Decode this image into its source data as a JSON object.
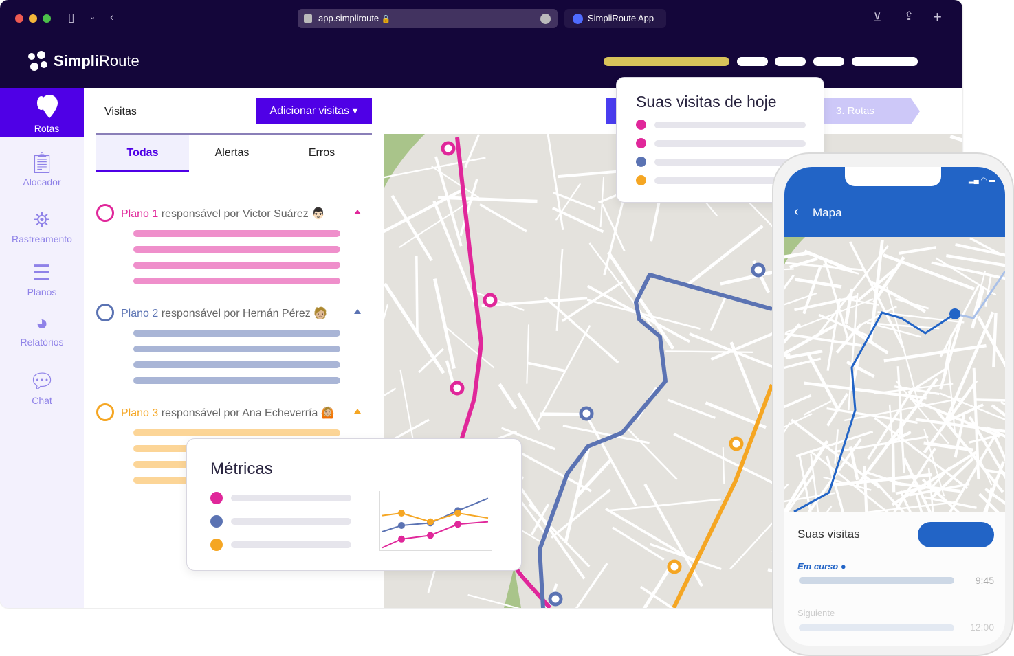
{
  "browser": {
    "url": "app.simpliroute",
    "tab_title": "SimpliRoute App"
  },
  "brand": {
    "name_bold": "Simpli",
    "name_light": "Route"
  },
  "colors": {
    "primary": "#4f00e6",
    "header": "#14063a",
    "plan1": "#e0279a",
    "plan2": "#5b73b3",
    "plan3": "#f5a623",
    "mobile": "#2264c6",
    "progress": "#d8c35a"
  },
  "sidebar": {
    "items": [
      {
        "label": "Rotas",
        "icon": "map-pin-icon"
      },
      {
        "label": "Alocador",
        "icon": "clipboard-icon"
      },
      {
        "label": "Rastreamento",
        "icon": "map-tracking-icon"
      },
      {
        "label": "Planos",
        "icon": "list-icon"
      },
      {
        "label": "Relatórios",
        "icon": "pie-chart-icon"
      },
      {
        "label": "Chat",
        "icon": "chat-icon"
      }
    ]
  },
  "panel": {
    "title": "Visitas",
    "add_button": "Adicionar visitas",
    "tabs": [
      "Todas",
      "Alertas",
      "Erros"
    ],
    "plans": [
      {
        "name": "Plano 1",
        "owner": "responsável por Victor Suárez",
        "emoji": "👨🏻"
      },
      {
        "name": "Plano 2",
        "owner": "responsável por Hernán Pérez",
        "emoji": "🧑🏼"
      },
      {
        "name": "Plano 3",
        "owner": "responsável por Ana Echeverría",
        "emoji": "🙆🏼"
      }
    ]
  },
  "stepper": {
    "step3": "3. Rotas"
  },
  "visits_card": {
    "title": "Suas visitas de hoje"
  },
  "metrics_card": {
    "title": "Métricas"
  },
  "chart_data": {
    "type": "line",
    "series": [
      {
        "color": "#5b73b3",
        "values": [
          1.5,
          2,
          2.2,
          3.2,
          4.2
        ]
      },
      {
        "color": "#f5a623",
        "values": [
          2.8,
          3,
          2.3,
          3,
          2.6
        ]
      },
      {
        "color": "#e0279a",
        "values": [
          0.2,
          0.9,
          1.2,
          2.1,
          2.3
        ]
      }
    ]
  },
  "phone": {
    "header": "Mapa",
    "section": "Suas visitas",
    "current_label": "Em curso",
    "current_time": "9:45",
    "next_label": "Siguiente",
    "next_time": "12:00"
  }
}
